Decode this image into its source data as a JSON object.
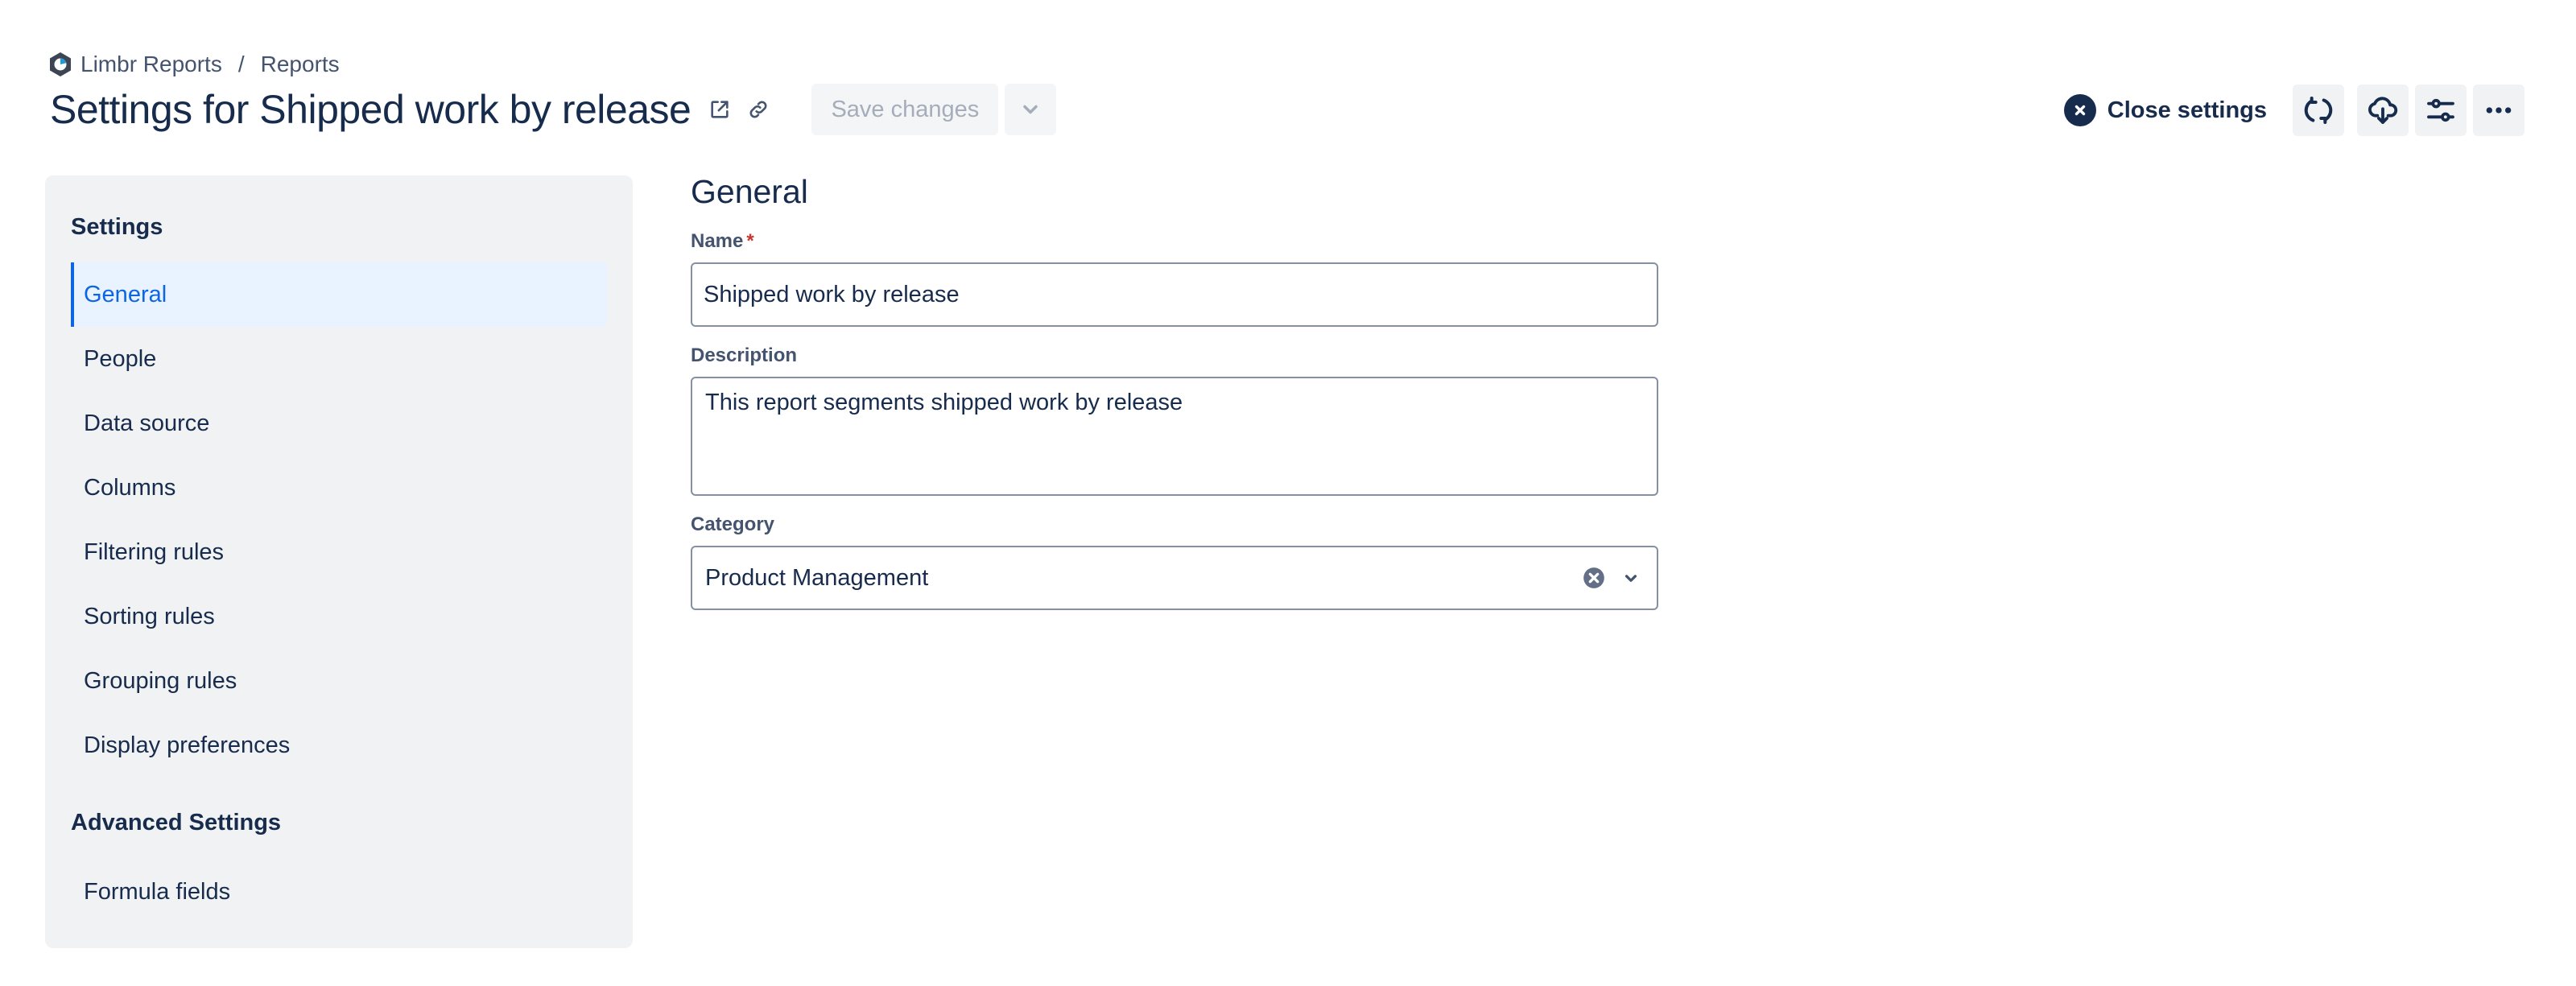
{
  "breadcrumb": {
    "items": [
      {
        "label": "Limbr Reports",
        "icon": "limbr-logo-icon"
      },
      {
        "label": "Reports"
      }
    ],
    "separator": "/"
  },
  "header": {
    "title": "Settings for Shipped work by release",
    "title_icons": [
      "external-link-icon",
      "link-icon"
    ],
    "save_label": "Save changes",
    "save_enabled": false,
    "save_dropdown_icon": "chevron-down-icon",
    "close_settings_label": "Close settings",
    "action_icons": [
      "refresh-icon",
      "cloud-download-icon",
      "sliders-icon",
      "more-icon"
    ]
  },
  "sidebar": {
    "heading": "Settings",
    "items": [
      {
        "label": "General",
        "active": true
      },
      {
        "label": "People",
        "active": false
      },
      {
        "label": "Data source",
        "active": false
      },
      {
        "label": "Columns",
        "active": false
      },
      {
        "label": "Filtering rules",
        "active": false
      },
      {
        "label": "Sorting rules",
        "active": false
      },
      {
        "label": "Grouping rules",
        "active": false
      },
      {
        "label": "Display preferences",
        "active": false
      }
    ],
    "advanced_heading": "Advanced Settings",
    "advanced_items": [
      {
        "label": "Formula fields",
        "active": false
      }
    ]
  },
  "form": {
    "section_title": "General",
    "name": {
      "label": "Name",
      "required_marker": "*",
      "value": "Shipped work by release"
    },
    "description": {
      "label": "Description",
      "value": "This report segments shipped work by release"
    },
    "category": {
      "label": "Category",
      "value": "Product Management"
    }
  },
  "colors": {
    "text_primary": "#172b4d",
    "text_subtle": "#44546f",
    "accent": "#0c66e4",
    "active_bg": "#e9f2ff",
    "sidebar_bg": "#f1f2f4",
    "required": "#c9372c",
    "border": "#8590a2"
  }
}
